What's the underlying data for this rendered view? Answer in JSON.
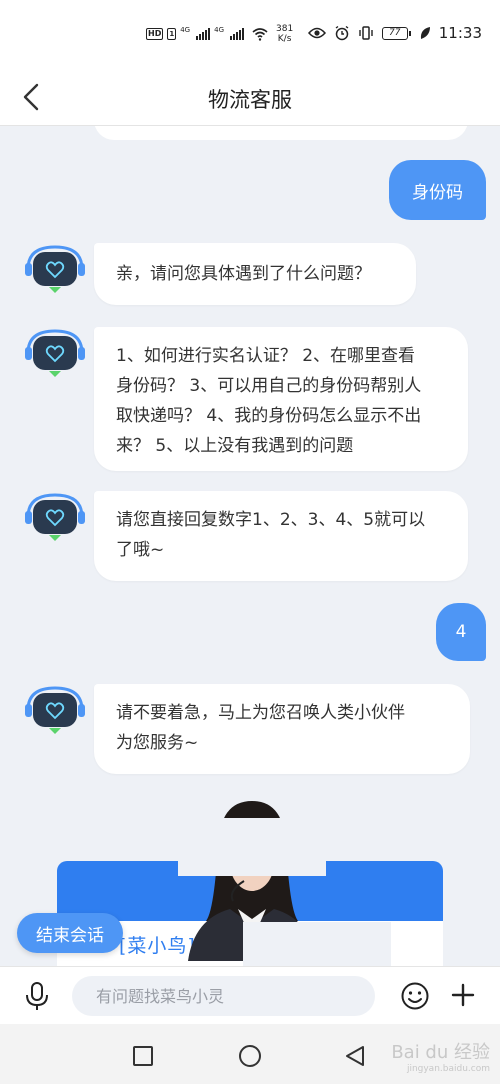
{
  "status_bar": {
    "network_speed_value": "381",
    "network_speed_unit": "K/s",
    "signal_labels": [
      "4G",
      "4G"
    ],
    "battery_level": "77",
    "time": "11:33"
  },
  "nav": {
    "title": "物流客服"
  },
  "messages": [
    {
      "sender": "user",
      "text": "身份码"
    },
    {
      "sender": "bot",
      "lines": [
        "亲，请问您具体遇到了什么问题？"
      ]
    },
    {
      "sender": "bot",
      "lines": [
        "1、如何进行实名认证？ 2、在哪里查看",
        "身份码？ 3、可以用自己的身份码帮别人",
        "取快递吗？ 4、我的身份码怎么显示不出",
        "来？ 5、以上没有我遇到的问题"
      ]
    },
    {
      "sender": "bot",
      "lines": [
        "请您直接回复数字1、2、3、4、5就可以",
        "了哦~"
      ]
    },
    {
      "sender": "user",
      "text": "4"
    },
    {
      "sender": "bot",
      "lines": [
        "请不要着急，马上为您召唤人类小伙伴",
        "为您服务~"
      ]
    }
  ],
  "agent_card": {
    "label": "[菜小鸟] 菜鸟"
  },
  "end_session_label": "结束会话",
  "input": {
    "placeholder": "有问题找菜鸟小灵"
  },
  "watermark": {
    "text": "Bai du 经验",
    "sub": "jingyan.baidu.com"
  },
  "colors": {
    "accent": "#4e96f5",
    "card_blue": "#2f7ef0",
    "background": "#eef1f6"
  },
  "icons": {
    "back": "chevron-left-icon",
    "mic": "microphone-icon",
    "emoji": "smiley-icon",
    "plus": "plus-icon",
    "bot_avatar": "robot-headset-icon"
  }
}
